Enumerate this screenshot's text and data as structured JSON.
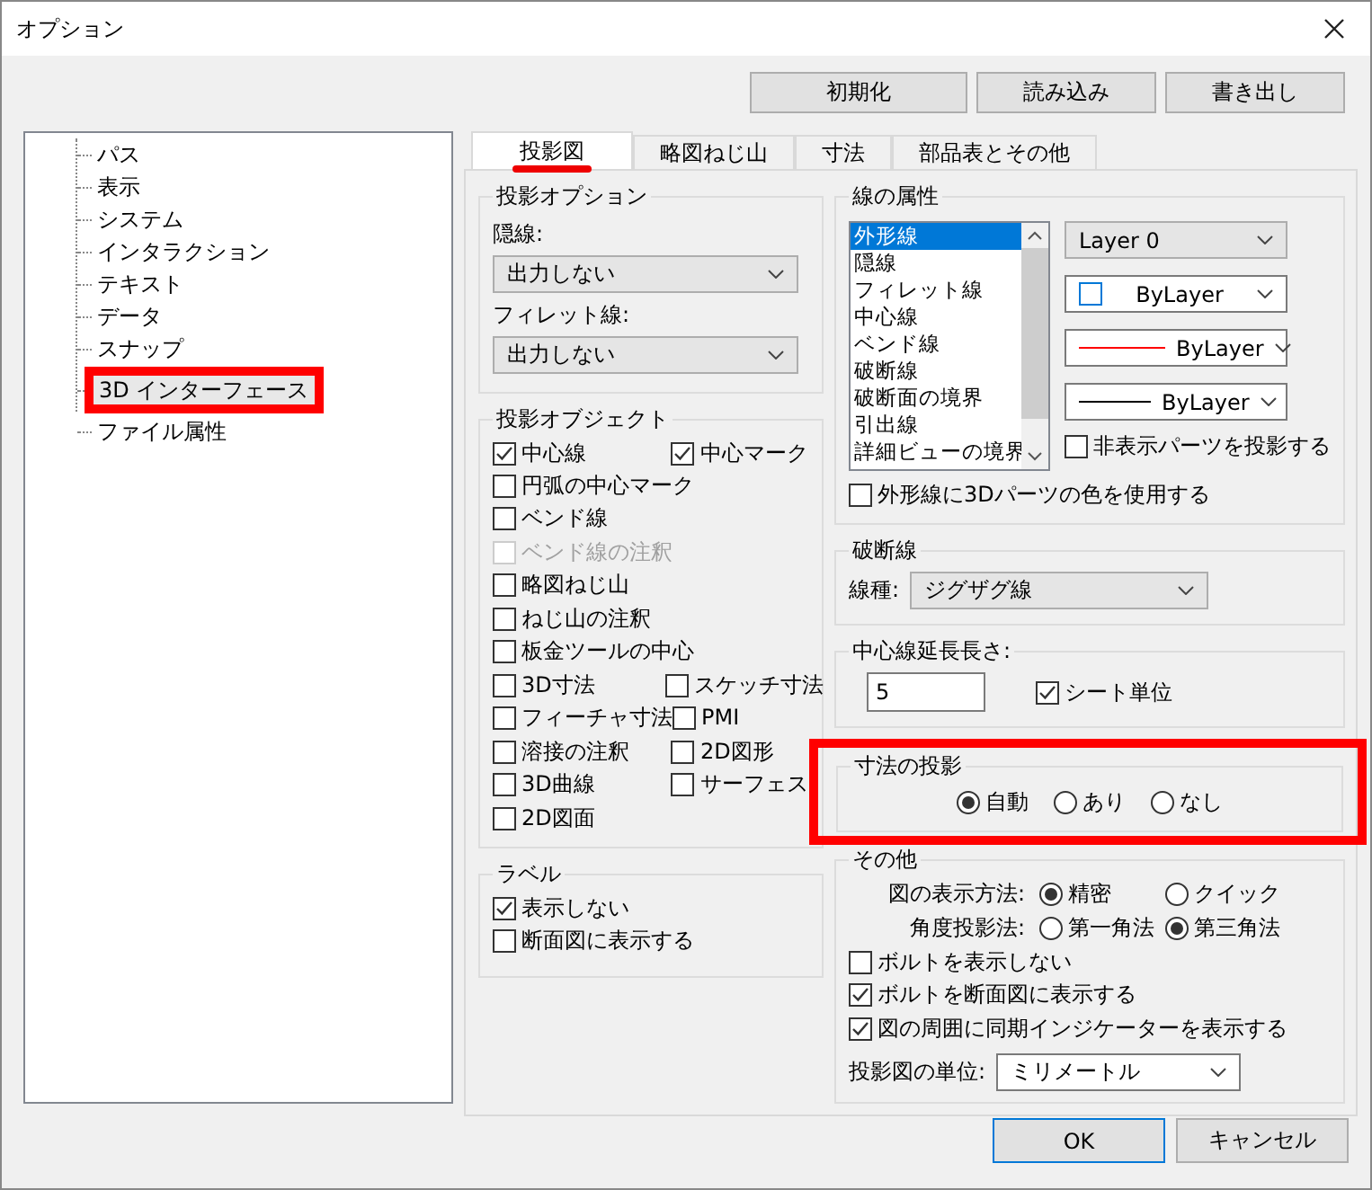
{
  "window": {
    "title": "オプション"
  },
  "toolbar_buttons": [
    "初期化",
    "読み込み",
    "書き出し"
  ],
  "tree": {
    "items": [
      {
        "label": "パス",
        "selected": false,
        "annotated": false
      },
      {
        "label": "表示",
        "selected": false,
        "annotated": false
      },
      {
        "label": "システム",
        "selected": false,
        "annotated": false
      },
      {
        "label": "インタラクション",
        "selected": false,
        "annotated": false
      },
      {
        "label": "テキスト",
        "selected": false,
        "annotated": false
      },
      {
        "label": "データ",
        "selected": false,
        "annotated": false
      },
      {
        "label": "スナップ",
        "selected": false,
        "annotated": false
      },
      {
        "label": "3D インターフェース",
        "selected": true,
        "annotated": true
      },
      {
        "label": "ファイル属性",
        "selected": false,
        "annotated": false
      }
    ]
  },
  "tabs": [
    {
      "label": "投影図",
      "selected": true,
      "annotated": true
    },
    {
      "label": "略図ねじ山",
      "selected": false,
      "annotated": false
    },
    {
      "label": "寸法",
      "selected": false,
      "annotated": false
    },
    {
      "label": "部品表とその他",
      "selected": false,
      "annotated": false
    }
  ],
  "projection_options": {
    "title": "投影オプション",
    "fields": [
      {
        "label": "隠線:",
        "value": "出力しない"
      },
      {
        "label": "フィレット線:",
        "value": "出力しない"
      }
    ]
  },
  "projection_objects": {
    "title": "投影オブジェクト",
    "rows": [
      [
        {
          "label": "中心線",
          "checked": true,
          "disabled": false
        },
        {
          "label": "中心マーク",
          "checked": true,
          "disabled": false
        }
      ],
      [
        {
          "label": "円弧の中心マーク",
          "checked": false,
          "disabled": false
        }
      ],
      [
        {
          "label": "ベンド線",
          "checked": false,
          "disabled": false
        }
      ],
      [
        {
          "label": "ベンド線の注釈",
          "checked": false,
          "disabled": true
        }
      ],
      [
        {
          "label": "略図ねじ山",
          "checked": false,
          "disabled": false
        }
      ],
      [
        {
          "label": "ねじ山の注釈",
          "checked": false,
          "disabled": false
        }
      ],
      [
        {
          "label": "板金ツールの中心",
          "checked": false,
          "disabled": false
        }
      ],
      [
        {
          "label": "3D寸法",
          "checked": false,
          "disabled": false
        },
        {
          "label": "スケッチ寸法",
          "checked": false,
          "disabled": false
        }
      ],
      [
        {
          "label": "フィーチャ寸法",
          "checked": false,
          "disabled": false
        },
        {
          "label": "PMI",
          "checked": false,
          "disabled": false
        }
      ],
      [
        {
          "label": "溶接の注釈",
          "checked": false,
          "disabled": false
        },
        {
          "label": "2D図形",
          "checked": false,
          "disabled": false
        }
      ],
      [
        {
          "label": "3D曲線",
          "checked": false,
          "disabled": false
        },
        {
          "label": "サーフェス",
          "checked": false,
          "disabled": false
        }
      ],
      [
        {
          "label": "2D図面",
          "checked": false,
          "disabled": false
        }
      ]
    ]
  },
  "labels": {
    "title": "ラベル",
    "items": [
      {
        "label": "表示しない",
        "checked": true
      },
      {
        "label": "断面図に表示する",
        "checked": false
      }
    ]
  },
  "line_attributes": {
    "title": "線の属性",
    "list_items": [
      {
        "label": "外形線",
        "selected": true
      },
      {
        "label": "隠線",
        "selected": false
      },
      {
        "label": "フィレット線",
        "selected": false
      },
      {
        "label": "中心線",
        "selected": false
      },
      {
        "label": "ベンド線",
        "selected": false
      },
      {
        "label": "破断線",
        "selected": false
      },
      {
        "label": "破断面の境界",
        "selected": false
      },
      {
        "label": "引出線",
        "selected": false
      },
      {
        "label": "詳細ビューの境界",
        "selected": false
      }
    ],
    "layer": "Layer 0",
    "color_setting": "ByLayer",
    "line_type": "ByLayer",
    "line_width": "ByLayer",
    "hidden_parts": {
      "label": "非表示パーツを投影する",
      "checked": false
    },
    "use_3d_color": {
      "label": "外形線に3Dパーツの色を使用する",
      "checked": false
    }
  },
  "break_line": {
    "title": "破断線",
    "label": "線種:",
    "value": "ジグザグ線"
  },
  "centerline_extension": {
    "title": "中心線延長長さ:",
    "value": "5",
    "sheet_units": {
      "label": "シート単位",
      "checked": true
    }
  },
  "dimension_projection": {
    "title": "寸法の投影",
    "annotated": true,
    "options": [
      {
        "label": "自動",
        "selected": true
      },
      {
        "label": "あり",
        "selected": false
      },
      {
        "label": "なし",
        "selected": false
      }
    ]
  },
  "other": {
    "title": "その他",
    "rows": [
      {
        "label": "図の表示方法:",
        "options": [
          {
            "label": "精密",
            "selected": true
          },
          {
            "label": "クイック",
            "selected": false
          }
        ]
      },
      {
        "label": "角度投影法:",
        "options": [
          {
            "label": "第一角法",
            "selected": false
          },
          {
            "label": "第三角法",
            "selected": true
          }
        ]
      }
    ],
    "checkboxes": [
      {
        "label": "ボルトを表示しない",
        "checked": false
      },
      {
        "label": "ボルトを断面図に表示する",
        "checked": true
      },
      {
        "label": "図の周囲に同期インジケーターを表示する",
        "checked": true
      }
    ],
    "unit": {
      "label": "投影図の単位:",
      "value": "ミリメートル"
    }
  },
  "footer_buttons": [
    {
      "label": "OK",
      "default": true
    },
    {
      "label": "キャンセル",
      "default": false
    }
  ]
}
